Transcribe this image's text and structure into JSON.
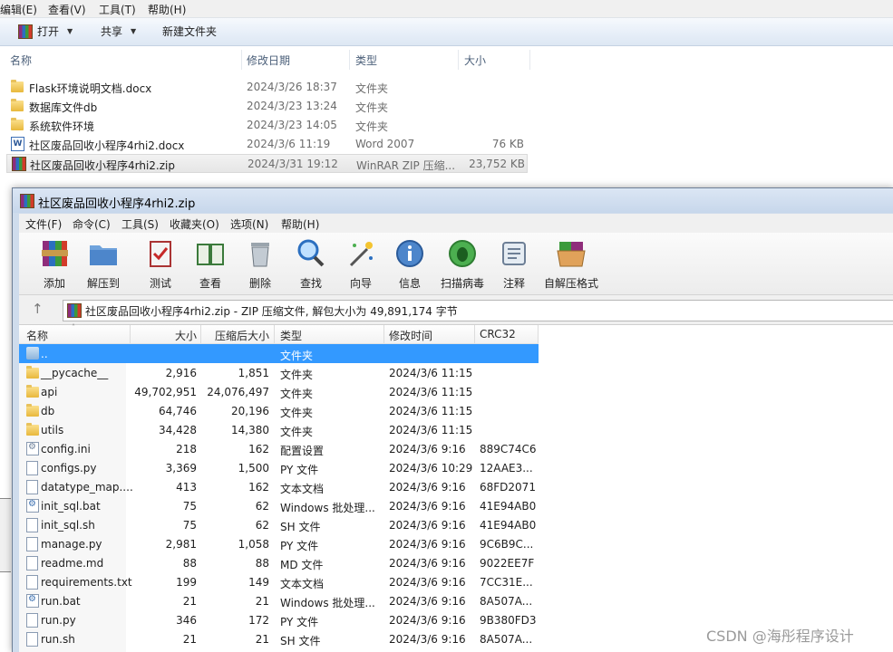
{
  "explorer": {
    "menu": [
      "编辑(E)",
      "查看(V)",
      "工具(T)",
      "帮助(H)"
    ],
    "toolbar": {
      "open": "打开",
      "share": "共享",
      "new_folder": "新建文件夹"
    },
    "columns": {
      "name": "名称",
      "modified": "修改日期",
      "type": "类型",
      "size": "大小"
    },
    "files": [
      {
        "name": "Flask环境说明文档.docx",
        "modified": "2024/3/26 18:37",
        "type": "文件夹",
        "size": "",
        "icon": "folder-icon"
      },
      {
        "name": "数据库文件db",
        "modified": "2024/3/23 13:24",
        "type": "文件夹",
        "size": "",
        "icon": "folder-icon"
      },
      {
        "name": "系统软件环境",
        "modified": "2024/3/23 14:05",
        "type": "文件夹",
        "size": "",
        "icon": "folder-icon"
      },
      {
        "name": "社区废品回收小程序4rhi2.docx",
        "modified": "2024/3/6 11:19",
        "type": "Word 2007",
        "size": "76 KB",
        "icon": "word-icon"
      },
      {
        "name": "社区废品回收小程序4rhi2.zip",
        "modified": "2024/3/31 19:12",
        "type": "WinRAR ZIP 压缩...",
        "size": "23,752 KB",
        "icon": "winrar-icon"
      }
    ]
  },
  "winrar": {
    "title": "社区废品回收小程序4rhi2.zip",
    "menu": [
      "文件(F)",
      "命令(C)",
      "工具(S)",
      "收藏夹(O)",
      "选项(N)",
      "帮助(H)"
    ],
    "tools": [
      "添加",
      "解压到",
      "测试",
      "查看",
      "删除",
      "查找",
      "向导",
      "信息",
      "扫描病毒",
      "注释",
      "自解压格式"
    ],
    "address": "社区废品回收小程序4rhi2.zip - ZIP 压缩文件, 解包大小为 49,891,174 字节",
    "columns": {
      "name": "名称",
      "size": "大小",
      "packed": "压缩后大小",
      "type": "类型",
      "modified": "修改时间",
      "crc": "CRC32"
    },
    "rows": [
      {
        "name": "..",
        "size": "",
        "packed": "",
        "type": "文件夹",
        "modified": "",
        "crc": "",
        "icon": "up-folder-icon"
      },
      {
        "name": "__pycache__",
        "size": "2,916",
        "packed": "1,851",
        "type": "文件夹",
        "modified": "2024/3/6 11:15",
        "crc": "",
        "icon": "folder-icon"
      },
      {
        "name": "api",
        "size": "49,702,951",
        "packed": "24,076,497",
        "type": "文件夹",
        "modified": "2024/3/6 11:15",
        "crc": "",
        "icon": "folder-icon"
      },
      {
        "name": "db",
        "size": "64,746",
        "packed": "20,196",
        "type": "文件夹",
        "modified": "2024/3/6 11:15",
        "crc": "",
        "icon": "folder-icon"
      },
      {
        "name": "utils",
        "size": "34,428",
        "packed": "14,380",
        "type": "文件夹",
        "modified": "2024/3/6 11:15",
        "crc": "",
        "icon": "folder-icon"
      },
      {
        "name": "config.ini",
        "size": "218",
        "packed": "162",
        "type": "配置设置",
        "modified": "2024/3/6 9:16",
        "crc": "889C74C6",
        "icon": "config-file-icon"
      },
      {
        "name": "configs.py",
        "size": "3,369",
        "packed": "1,500",
        "type": "PY 文件",
        "modified": "2024/3/6 10:29",
        "crc": "12AAE3...",
        "icon": "file-icon"
      },
      {
        "name": "datatype_map....",
        "size": "413",
        "packed": "162",
        "type": "文本文档",
        "modified": "2024/3/6 9:16",
        "crc": "68FD2071",
        "icon": "file-icon"
      },
      {
        "name": "init_sql.bat",
        "size": "75",
        "packed": "62",
        "type": "Windows 批处理...",
        "modified": "2024/3/6 9:16",
        "crc": "41E94AB0",
        "icon": "batch-file-icon"
      },
      {
        "name": "init_sql.sh",
        "size": "75",
        "packed": "62",
        "type": "SH 文件",
        "modified": "2024/3/6 9:16",
        "crc": "41E94AB0",
        "icon": "file-icon"
      },
      {
        "name": "manage.py",
        "size": "2,981",
        "packed": "1,058",
        "type": "PY 文件",
        "modified": "2024/3/6 9:16",
        "crc": "9C6B9C...",
        "icon": "file-icon"
      },
      {
        "name": "readme.md",
        "size": "88",
        "packed": "88",
        "type": "MD 文件",
        "modified": "2024/3/6 9:16",
        "crc": "9022EE7F",
        "icon": "file-icon"
      },
      {
        "name": "requirements.txt",
        "size": "199",
        "packed": "149",
        "type": "文本文档",
        "modified": "2024/3/6 9:16",
        "crc": "7CC31E...",
        "icon": "file-icon"
      },
      {
        "name": "run.bat",
        "size": "21",
        "packed": "21",
        "type": "Windows 批处理...",
        "modified": "2024/3/6 9:16",
        "crc": "8A507A...",
        "icon": "batch-file-icon"
      },
      {
        "name": "run.py",
        "size": "346",
        "packed": "172",
        "type": "PY 文件",
        "modified": "2024/3/6 9:16",
        "crc": "9B380FD3",
        "icon": "file-icon"
      },
      {
        "name": "run.sh",
        "size": "21",
        "packed": "21",
        "type": "SH 文件",
        "modified": "2024/3/6 9:16",
        "crc": "8A507A...",
        "icon": "file-icon"
      }
    ]
  },
  "watermark": "CSDN @海彤程序设计"
}
